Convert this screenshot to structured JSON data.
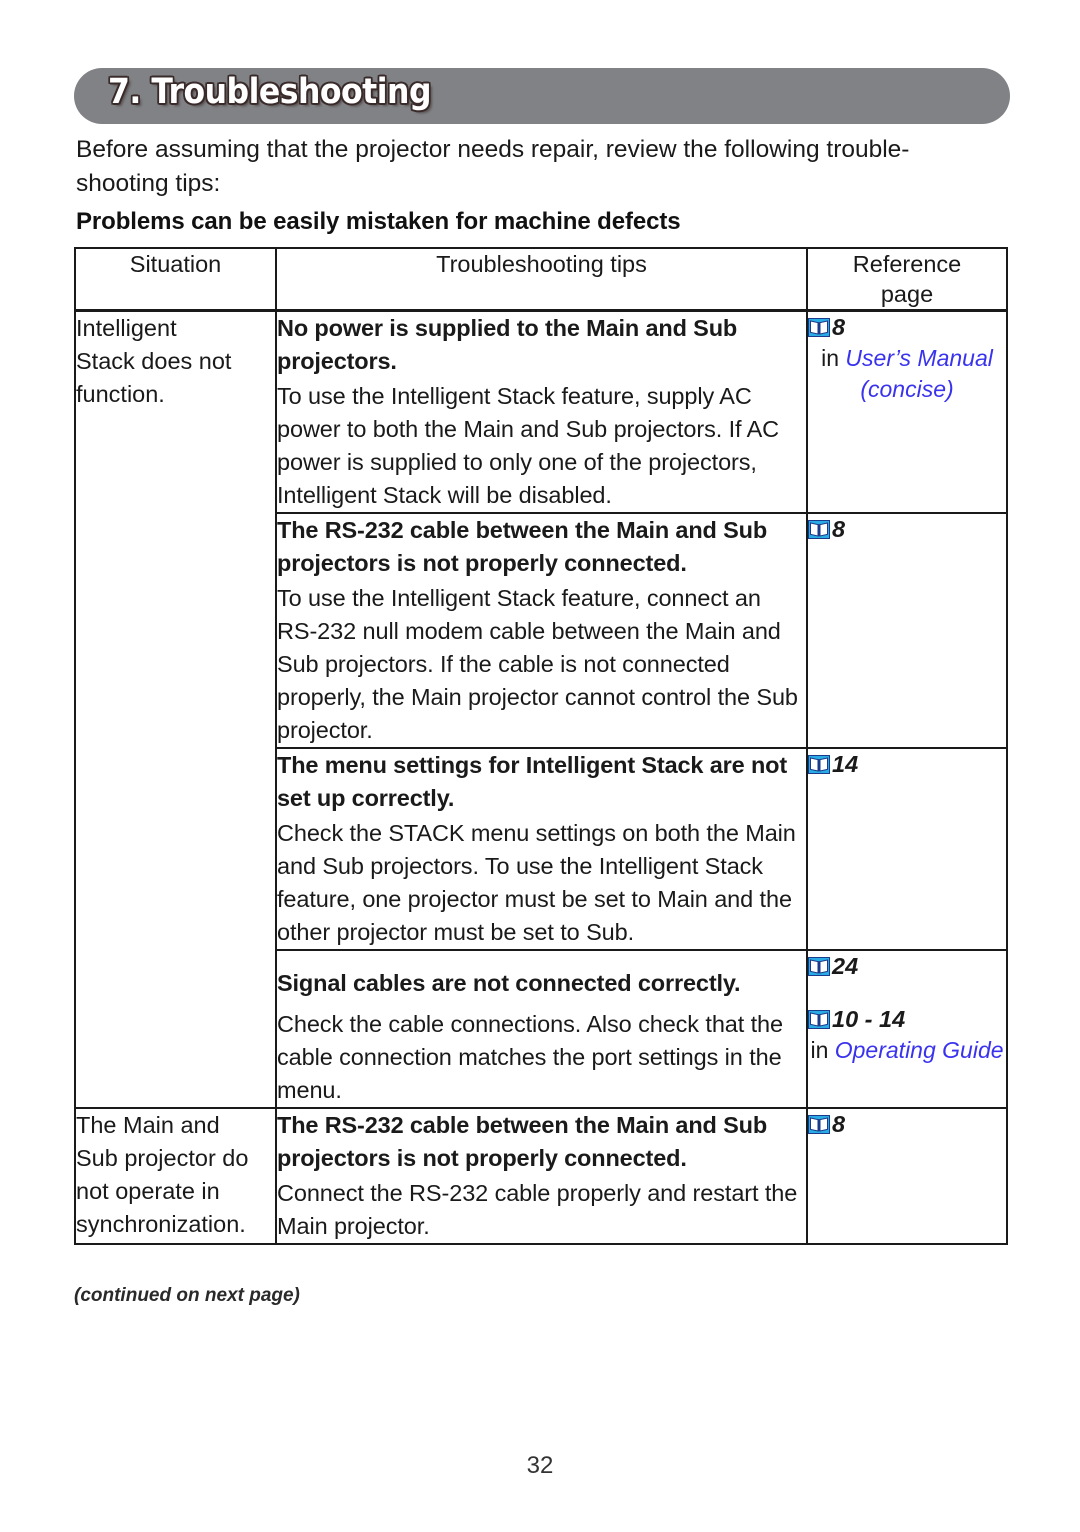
{
  "banner": {
    "title": "7. Troubleshooting"
  },
  "intro": "Before assuming that the projector needs repair, review the following trouble-shooting tips:",
  "section_heading": "Problems can be easily mistaken for machine defects",
  "table": {
    "headers": {
      "situation": "Situation",
      "tips": "Troubleshooting tips",
      "reference": "Reference\npage"
    },
    "situations": [
      "Intelligent\nStack does not\nfunction.",
      "The Main and\nSub projector do\nnot operate in\nsynchronization."
    ],
    "rows": [
      {
        "title": "No power is supplied to the Main and Sub projectors.",
        "body": "To use the Intelligent Stack feature, supply AC power to both the Main and Sub projectors. If AC power is supplied to only one of the projectors, Intelligent Stack will be disabled.",
        "ref_page": "8",
        "ref_note_prefix": "in ",
        "ref_note_italic": "User’s Manual (concise)"
      },
      {
        "title": "The RS-232 cable between the Main and Sub projectors is not properly connected.",
        "body": "To use the Intelligent Stack feature, connect an RS-232 null modem cable between the Main and Sub projectors. If the cable is not connected properly, the Main projector cannot control the Sub projector.",
        "ref_page": "8",
        "ref_note_prefix": "",
        "ref_note_italic": ""
      },
      {
        "title": "The menu settings for Intelligent Stack are not set up correctly.",
        "body": "Check the STACK menu settings on both the Main and Sub projectors. To use the Intelligent Stack feature, one projector must be set to Main and the other projector must be set to Sub.",
        "ref_page": "14",
        "ref_note_prefix": "",
        "ref_note_italic": ""
      },
      {
        "title": "Signal cables are not connected correctly.",
        "body": "Check the cable connections. Also check that the cable connection matches the port settings in the menu.",
        "ref_page": "24",
        "ref_page_2": "10 - 14",
        "ref_note_prefix": "in ",
        "ref_note_italic": "Operating Guide"
      },
      {
        "title": "The RS-232 cable between the Main and Sub projectors is not properly connected.",
        "body": "Connect the RS-232 cable properly and restart the Main projector.",
        "ref_page": "8",
        "ref_note_prefix": "",
        "ref_note_italic": ""
      }
    ]
  },
  "footer": {
    "continued": "(continued on next page)",
    "page_number": "32"
  },
  "colors": {
    "banner_gray": "#808285",
    "link_blue": "#3a33ee",
    "book_icon_cyan": "#29ace3",
    "book_icon_outline": "#1b3a8c",
    "rule_black": "#1a1a1a"
  },
  "icons": {
    "book": "book-icon"
  }
}
